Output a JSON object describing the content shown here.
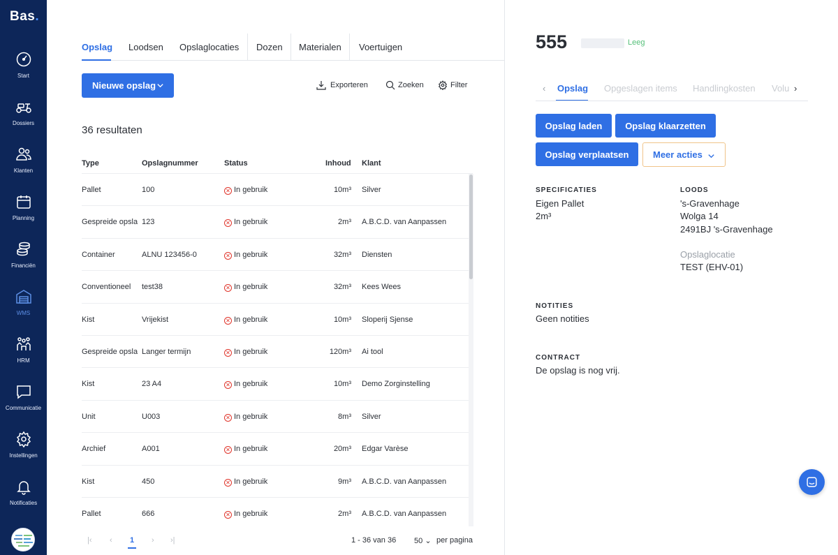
{
  "sidebar": {
    "logo_text": "Bas",
    "logo_dot": ".",
    "items": [
      {
        "label": "Start",
        "icon": "gauge-icon"
      },
      {
        "label": "Dossiers",
        "icon": "scooter-icon"
      },
      {
        "label": "Klanten",
        "icon": "users-icon"
      },
      {
        "label": "Planning",
        "icon": "calendar-icon"
      },
      {
        "label": "Financiën",
        "icon": "coins-icon"
      },
      {
        "label": "WMS",
        "icon": "warehouse-icon",
        "active": true
      },
      {
        "label": "HRM",
        "icon": "team-icon"
      },
      {
        "label": "Communicatie",
        "icon": "chat-icon"
      },
      {
        "label": "Instellingen",
        "icon": "gear-icon"
      },
      {
        "label": "Notificaties",
        "icon": "bell-icon"
      }
    ]
  },
  "tabs": [
    "Opslag",
    "Loodsen",
    "Opslaglocaties",
    "Dozen",
    "Materialen",
    "Voertuigen"
  ],
  "active_tab": "Opslag",
  "toolbar": {
    "new_label": "Nieuwe opslag",
    "export_label": "Exporteren",
    "search_label": "Zoeken",
    "filter_label": "Filter"
  },
  "results_label": "36 resultaten",
  "table": {
    "headers": [
      "Type",
      "Opslagnummer",
      "Status",
      "Inhoud",
      "Klant"
    ],
    "rows": [
      {
        "type": "Pallet",
        "num": "100",
        "status": "In gebruik",
        "inhoud": "10m³",
        "klant": "Silver"
      },
      {
        "type": "Gespreide opslag",
        "num": "123",
        "status": "In gebruik",
        "inhoud": "2m³",
        "klant": "A.B.C.D. van Aanpassen"
      },
      {
        "type": "Container",
        "num": "ALNU 123456-0",
        "status": "In gebruik",
        "inhoud": "32m³",
        "klant": "Diensten"
      },
      {
        "type": "Conventioneel",
        "num": "test38",
        "status": "In gebruik",
        "inhoud": "32m³",
        "klant": "Kees Wees"
      },
      {
        "type": "Kist",
        "num": "Vrijekist",
        "status": "In gebruik",
        "inhoud": "10m³",
        "klant": "Sloperij Sjense"
      },
      {
        "type": "Gespreide opslag",
        "num": "Langer termijn",
        "status": "In gebruik",
        "inhoud": "120m³",
        "klant": "Ai tool"
      },
      {
        "type": "Kist",
        "num": "23 A4",
        "status": "In gebruik",
        "inhoud": "10m³",
        "klant": "Demo Zorginstelling"
      },
      {
        "type": "Unit",
        "num": "U003",
        "status": "In gebruik",
        "inhoud": "8m³",
        "klant": "Silver"
      },
      {
        "type": "Archief",
        "num": "A001",
        "status": "In gebruik",
        "inhoud": "20m³",
        "klant": "Edgar Varèse"
      },
      {
        "type": "Kist",
        "num": "450",
        "status": "In gebruik",
        "inhoud": "9m³",
        "klant": "A.B.C.D. van Aanpassen"
      },
      {
        "type": "Pallet",
        "num": "666",
        "status": "In gebruik",
        "inhoud": "2m³",
        "klant": "A.B.C.D. van Aanpassen"
      }
    ]
  },
  "pagination": {
    "current_page": "1",
    "info": "1 - 36 van 36",
    "page_size": "50",
    "per_page_label": "per pagina"
  },
  "detail": {
    "title": "555",
    "status": "Leeg",
    "tabs": [
      "Opslag",
      "Opgeslagen items",
      "Handlingkosten",
      "Volu"
    ],
    "buttons": {
      "load": "Opslag laden",
      "ready": "Opslag klaarzetten",
      "move": "Opslag verplaatsen",
      "more": "Meer acties"
    },
    "specs": {
      "heading": "SPECIFICATIES",
      "line1": "Eigen Pallet",
      "line2": "2m³"
    },
    "loods": {
      "heading": "LOODS",
      "line1": "'s-Gravenhage",
      "line2": "Wolga 14",
      "line3": "2491BJ 's-Gravenhage",
      "location_label": "Opslaglocatie",
      "location_value": "TEST (EHV-01)"
    },
    "notes": {
      "heading": "NOTITIES",
      "text": "Geen notities"
    },
    "contract": {
      "heading": "CONTRACT",
      "text": "De opslag is nog vrij."
    }
  },
  "colors": {
    "sidebar": "#0d2659",
    "accent": "#2f6fe4",
    "danger": "#e0352b",
    "success": "#56c07a"
  }
}
